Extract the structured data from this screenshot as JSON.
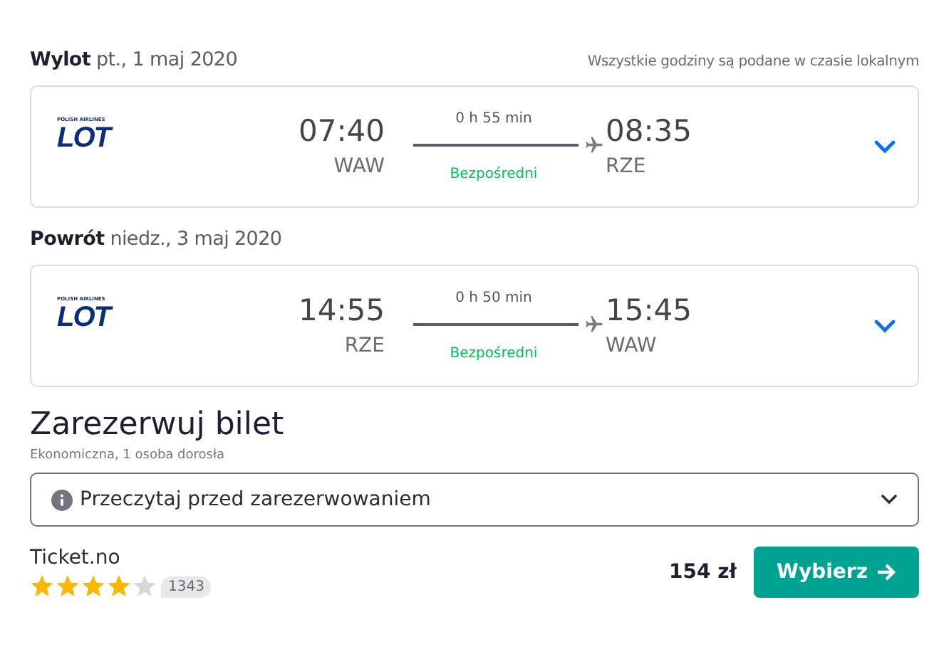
{
  "note": "Wszystkie godziny są podane w czasie lokalnym",
  "legs": [
    {
      "label": "Wylot",
      "date": "pt., 1 maj 2020",
      "airline": {
        "subtitle": "POLISH AIRLINES",
        "name": "LOT"
      },
      "depart_time": "07:40",
      "depart_code": "WAW",
      "duration": "0 h 55 min",
      "stops": "Bezpośredni",
      "arrive_time": "08:35",
      "arrive_code": "RZE",
      "expanded": false
    },
    {
      "label": "Powrót",
      "date": "niedz., 3 maj 2020",
      "airline": {
        "subtitle": "POLISH AIRLINES",
        "name": "LOT"
      },
      "depart_time": "14:55",
      "depart_code": "RZE",
      "duration": "0 h 50 min",
      "stops": "Bezpośredni",
      "arrive_time": "15:45",
      "arrive_code": "WAW",
      "expanded": false
    }
  ],
  "booking": {
    "title": "Zarezerwuj bilet",
    "subtitle": "Ekonomiczna, 1 osoba dorosła",
    "info": "Przeczytaj przed zarezerwowaniem",
    "info_expanded": false
  },
  "offer": {
    "provider": "Ticket.no",
    "stars": 4,
    "reviews": "1343",
    "price": "154 zł",
    "button": "Wybierz"
  }
}
